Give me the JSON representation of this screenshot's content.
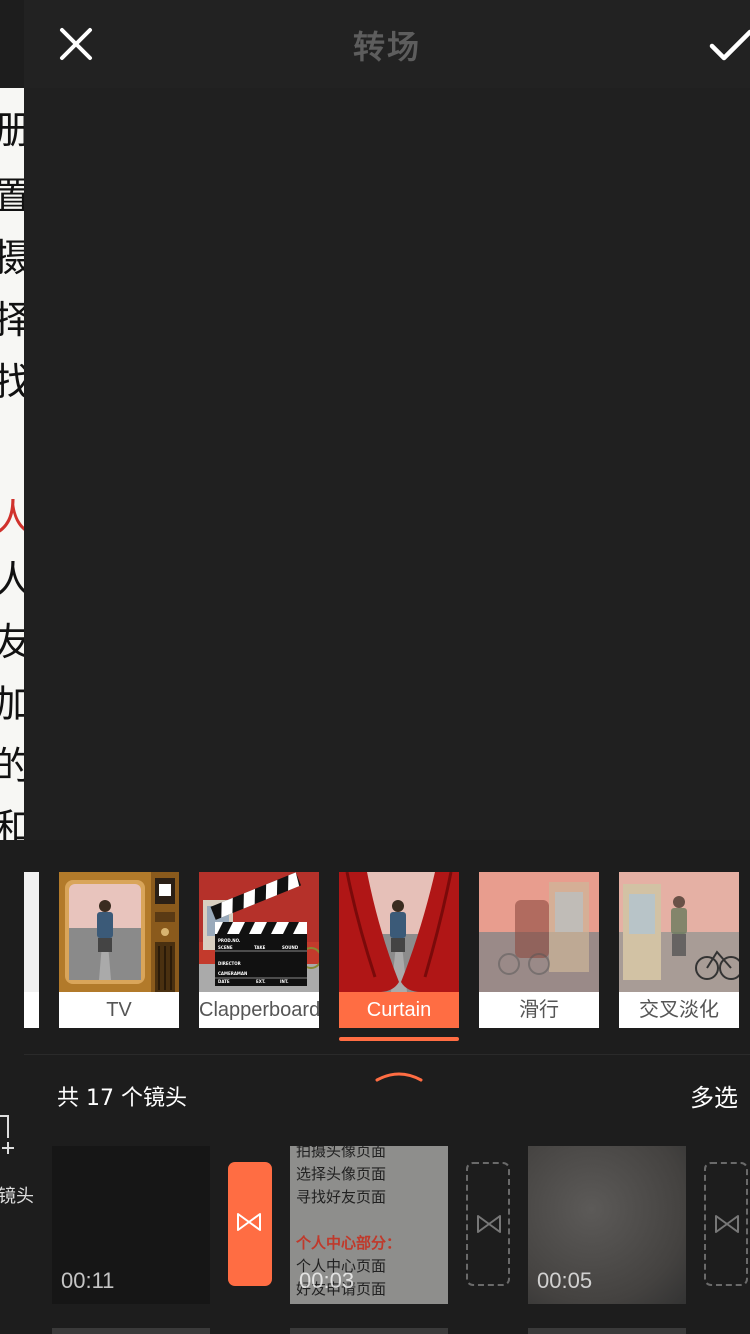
{
  "header": {
    "title": "转场",
    "close_icon": "close-icon",
    "confirm_icon": "check-icon"
  },
  "background_doc": {
    "chars": [
      "册",
      "置",
      "摄",
      "择",
      "找",
      "人",
      "人",
      "友",
      "加",
      "的",
      "和"
    ]
  },
  "transitions": {
    "items": [
      {
        "label": "TV",
        "selected": false
      },
      {
        "label": "Clapperboard",
        "selected": false
      },
      {
        "label": "Curtain",
        "selected": true
      },
      {
        "label": "滑行",
        "selected": false
      },
      {
        "label": "交叉淡化",
        "selected": false
      }
    ],
    "clapperboard_text": [
      "PROD.NO.",
      "SCENE",
      "TAKE",
      "SOUND",
      "DIRECTOR",
      "CAMERAMAN",
      "DATE",
      "EXT.",
      "INT."
    ]
  },
  "bottom": {
    "clip_count": "共 17 个镜头",
    "multi_select": "多选",
    "add_clip_label": "镜头",
    "clips": [
      {
        "time": "00:11"
      },
      {
        "time": "00:03",
        "lines": [
          "拍摄头像页面",
          "选择头像页面",
          "寻找好友页面",
          "",
          "个人中心部分：",
          "个人中心页面",
          "好友申请页面"
        ]
      },
      {
        "time": "00:05"
      }
    ]
  },
  "colors": {
    "accent": "#ff6d43",
    "background": "#1d1d1d",
    "header": "#222222"
  }
}
